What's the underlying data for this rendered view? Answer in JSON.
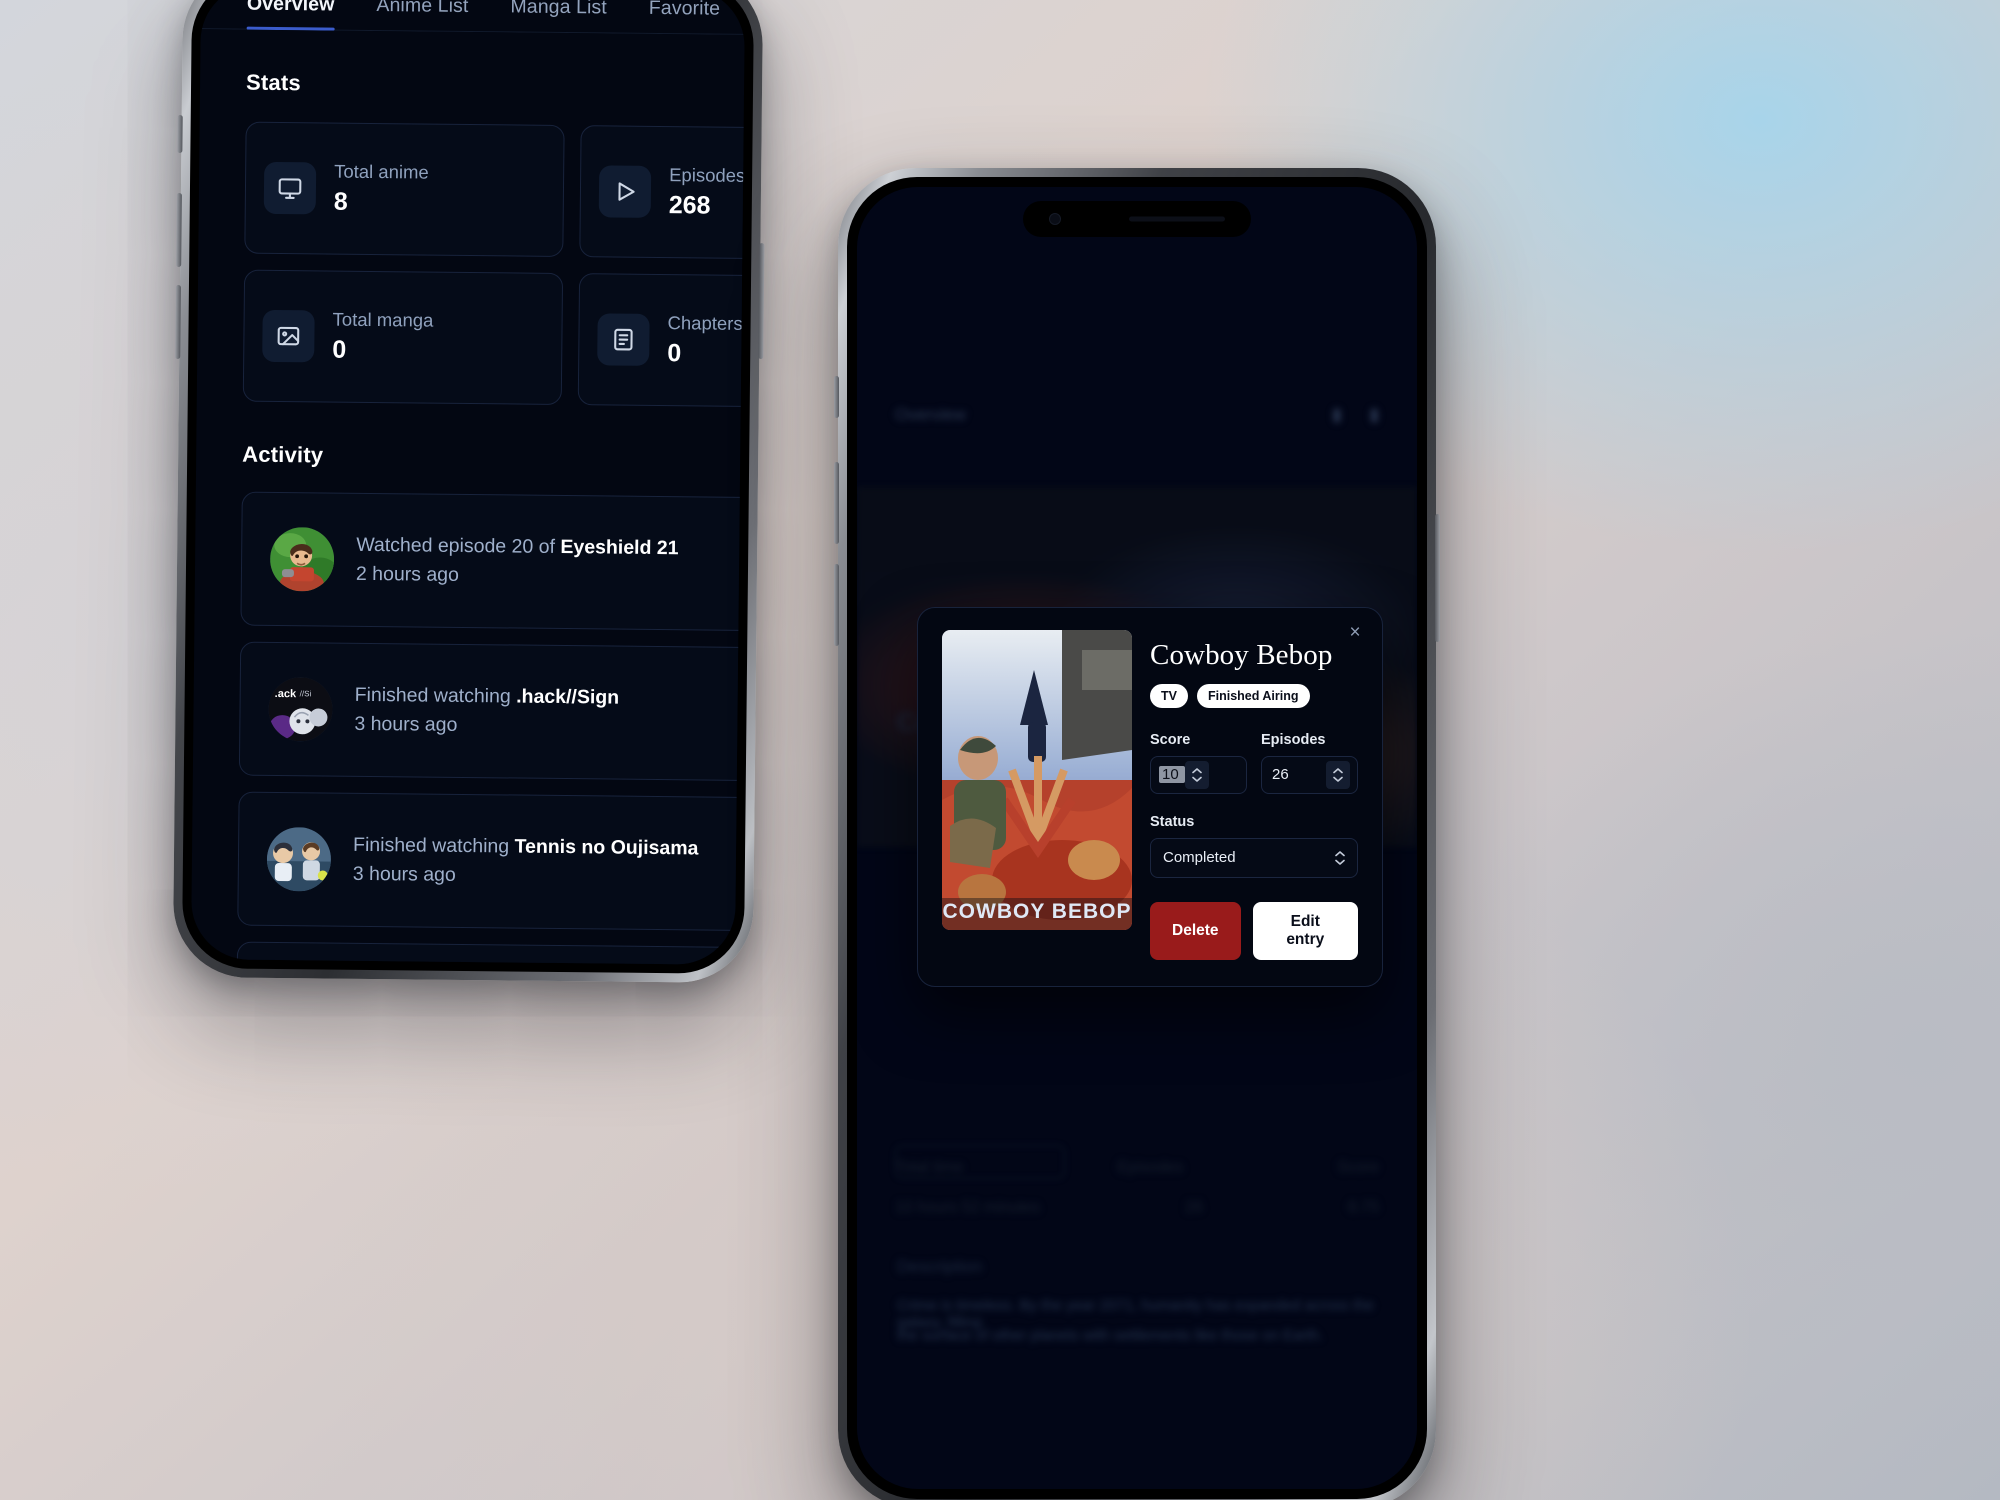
{
  "left_phone": {
    "tabs": [
      {
        "label": "Overview",
        "active": true
      },
      {
        "label": "Anime List",
        "active": false
      },
      {
        "label": "Manga List",
        "active": false
      },
      {
        "label": "Favorite",
        "active": false
      }
    ],
    "stats_section_title": "Stats",
    "stats": [
      {
        "label": "Total anime",
        "value": "8",
        "icon": "monitor-icon"
      },
      {
        "label": "Episodes",
        "value": "268",
        "icon": "play-icon"
      },
      {
        "label": "Total manga",
        "value": "0",
        "icon": "image-icon"
      },
      {
        "label": "Chapters",
        "value": "0",
        "icon": "document-icon"
      }
    ],
    "activity_section_title": "Activity",
    "activity": [
      {
        "prefix": "Watched episode 20 of ",
        "title": "Eyeshield 21",
        "time": "2 hours ago",
        "avatar": "eyeshield-21-avatar"
      },
      {
        "prefix": "Finished watching ",
        "title": ".hack//Sign",
        "time": "3 hours ago",
        "avatar": "hack-sign-avatar"
      },
      {
        "prefix": "Finished watching ",
        "title": "Tennis no Oujisama",
        "time": "3 hours ago",
        "avatar": "tennis-no-oujisama-avatar"
      }
    ]
  },
  "right_phone": {
    "modal": {
      "close_label": "×",
      "poster_alt": "cowboy-bebop-poster",
      "title": "Cowboy Bebop",
      "badges": [
        "TV",
        "Finished Airing"
      ],
      "score": {
        "label": "Score",
        "value": "10"
      },
      "episodes": {
        "label": "Episodes",
        "value": "26"
      },
      "status": {
        "label": "Status",
        "value": "Completed"
      },
      "delete_label": "Delete",
      "edit_label": "Edit entry"
    },
    "background_page": {
      "header": "Overview",
      "title": "Cowboy Bebop",
      "description_heading": "Description",
      "description_line_1": "Crime is timeless. By the year 2071, humanity has expanded across the galaxy, filling",
      "description_line_2": "the surface of other planets with settlements like those on Earth.",
      "meta_left_1": "Total time",
      "meta_mid_1": "Episodes",
      "meta_right_1": "Score",
      "meta_left_2": "10 hours 52 minutes",
      "meta_mid_2": "26",
      "meta_right_2": "8.75"
    }
  },
  "colors": {
    "accent": "#3b5ccc",
    "app_bg": "#030712",
    "card_bg": "#050b18",
    "card_border": "#18233c",
    "text_primary": "#ffffff",
    "text_muted": "#9fb0cb",
    "danger": "#991b1b",
    "badge_bg": "#ffffff"
  }
}
